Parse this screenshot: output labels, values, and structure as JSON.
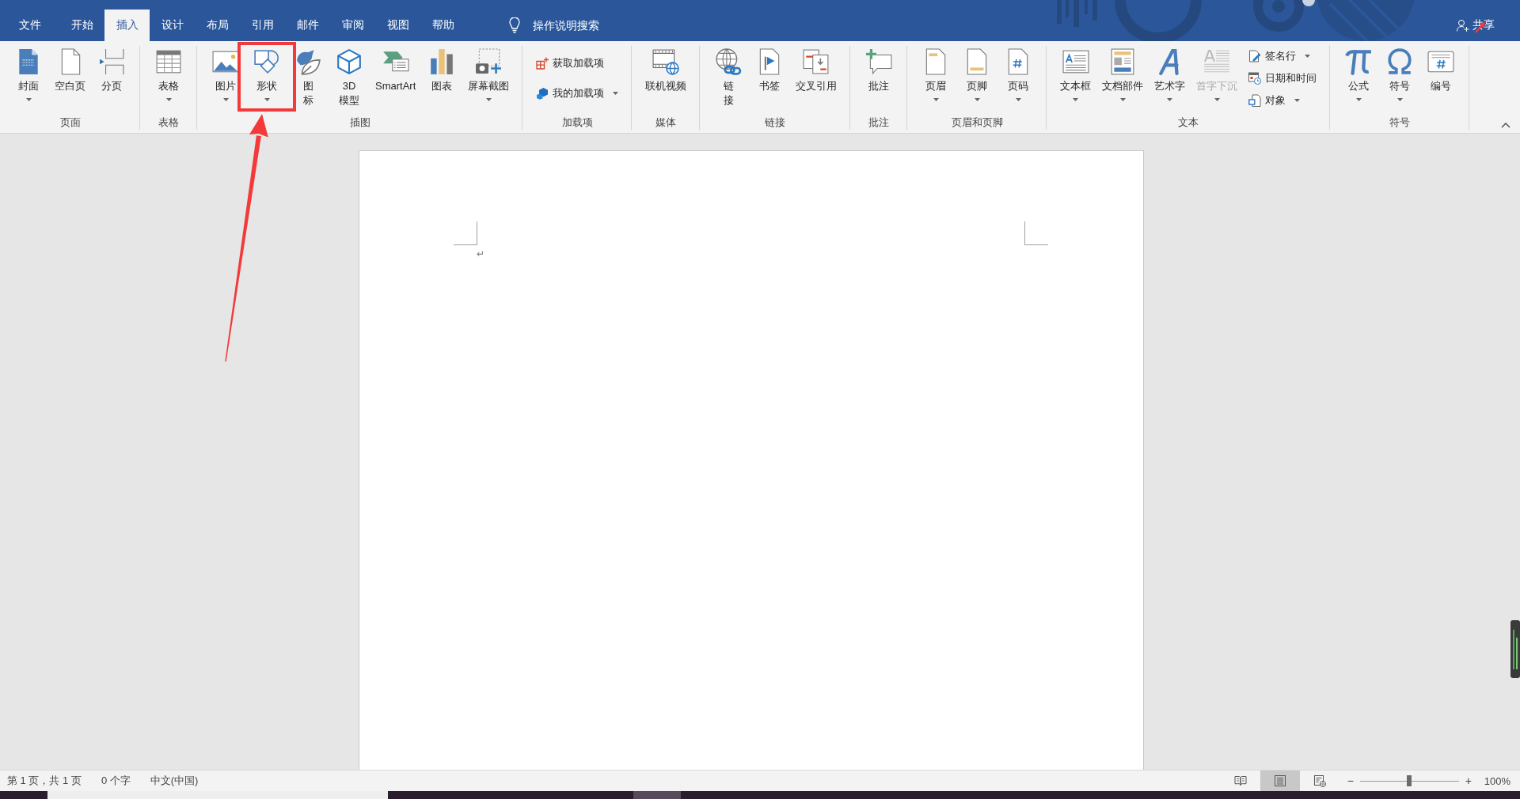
{
  "tabs": [
    {
      "label": "文件",
      "selected": false
    },
    {
      "label": "开始",
      "selected": false
    },
    {
      "label": "插入",
      "selected": true
    },
    {
      "label": "设计",
      "selected": false
    },
    {
      "label": "布局",
      "selected": false
    },
    {
      "label": "引用",
      "selected": false
    },
    {
      "label": "邮件",
      "selected": false
    },
    {
      "label": "审阅",
      "selected": false
    },
    {
      "label": "视图",
      "selected": false
    },
    {
      "label": "帮助",
      "selected": false
    }
  ],
  "tell_me": {
    "placeholder": "操作说明搜索"
  },
  "share": {
    "label": "共享"
  },
  "ribbon": {
    "groups": [
      {
        "label": "页面",
        "buttons": [
          {
            "kind": "large",
            "label": "封面",
            "dropdown": true,
            "disabled": false,
            "highlighted": false
          },
          {
            "kind": "large",
            "label": "空白页",
            "dropdown": false,
            "disabled": false,
            "highlighted": false
          },
          {
            "kind": "large",
            "label": "分页",
            "dropdown": false,
            "disabled": false,
            "highlighted": false
          }
        ]
      },
      {
        "label": "表格",
        "buttons": [
          {
            "kind": "large",
            "label": "表格",
            "dropdown": true,
            "disabled": false,
            "highlighted": false
          }
        ]
      },
      {
        "label": "插图",
        "buttons": [
          {
            "kind": "large",
            "label": "图片",
            "dropdown": true,
            "disabled": false,
            "highlighted": false
          },
          {
            "kind": "large",
            "label": "形状",
            "dropdown": true,
            "disabled": false,
            "highlighted": true
          },
          {
            "kind": "large",
            "label": "图标",
            "dropdown": false,
            "disabled": false,
            "highlighted": false
          },
          {
            "kind": "large",
            "label": "3D 模型",
            "dropdown": false,
            "disabled": false,
            "highlighted": false
          },
          {
            "kind": "large",
            "label": "SmartArt",
            "dropdown": false,
            "disabled": false,
            "highlighted": false
          },
          {
            "kind": "large",
            "label": "图表",
            "dropdown": false,
            "disabled": false,
            "highlighted": false
          },
          {
            "kind": "large",
            "label": "屏幕截图",
            "dropdown": true,
            "disabled": false,
            "highlighted": false
          }
        ]
      },
      {
        "label": "加载项",
        "buttons": [
          {
            "kind": "small",
            "label": "获取加载项",
            "dropdown": false,
            "disabled": false,
            "highlighted": false
          },
          {
            "kind": "small",
            "label": "我的加载项",
            "dropdown": true,
            "disabled": false,
            "highlighted": false
          }
        ]
      },
      {
        "label": "媒体",
        "buttons": [
          {
            "kind": "large",
            "label": "联机视频",
            "dropdown": false,
            "disabled": false,
            "highlighted": false
          }
        ]
      },
      {
        "label": "链接",
        "buttons": [
          {
            "kind": "large",
            "label": "链接",
            "dropdown": false,
            "disabled": false,
            "highlighted": false
          },
          {
            "kind": "large",
            "label": "书签",
            "dropdown": false,
            "disabled": false,
            "highlighted": false
          },
          {
            "kind": "large",
            "label": "交叉引用",
            "dropdown": false,
            "disabled": false,
            "highlighted": false
          }
        ]
      },
      {
        "label": "批注",
        "buttons": [
          {
            "kind": "large",
            "label": "批注",
            "dropdown": false,
            "disabled": false,
            "highlighted": false
          }
        ]
      },
      {
        "label": "页眉和页脚",
        "buttons": [
          {
            "kind": "large",
            "label": "页眉",
            "dropdown": true,
            "disabled": false,
            "highlighted": false
          },
          {
            "kind": "large",
            "label": "页脚",
            "dropdown": true,
            "disabled": false,
            "highlighted": false
          },
          {
            "kind": "large",
            "label": "页码",
            "dropdown": true,
            "disabled": false,
            "highlighted": false
          }
        ]
      },
      {
        "label": "文本",
        "buttons": [
          {
            "kind": "large",
            "label": "文本框",
            "dropdown": true,
            "disabled": false,
            "highlighted": false
          },
          {
            "kind": "large",
            "label": "文档部件",
            "dropdown": true,
            "disabled": false,
            "highlighted": false
          },
          {
            "kind": "large",
            "label": "艺术字",
            "dropdown": true,
            "disabled": false,
            "highlighted": false
          },
          {
            "kind": "large",
            "label": "首字下沉",
            "dropdown": true,
            "disabled": true,
            "highlighted": false
          },
          {
            "kind": "small",
            "label": "签名行",
            "dropdown": true,
            "disabled": false,
            "highlighted": false
          },
          {
            "kind": "small",
            "label": "日期和时间",
            "dropdown": false,
            "disabled": false,
            "highlighted": false
          },
          {
            "kind": "small",
            "label": "对象",
            "dropdown": true,
            "disabled": false,
            "highlighted": false
          }
        ]
      },
      {
        "label": "符号",
        "buttons": [
          {
            "kind": "large",
            "label": "公式",
            "dropdown": true,
            "disabled": false,
            "highlighted": false
          },
          {
            "kind": "large",
            "label": "符号",
            "dropdown": true,
            "disabled": false,
            "highlighted": false
          },
          {
            "kind": "large",
            "label": "编号",
            "dropdown": false,
            "disabled": false,
            "highlighted": false
          }
        ]
      }
    ]
  },
  "document": {
    "paragraph_mark": "↵"
  },
  "status_bar": {
    "items": [
      "第 1 页，共 1 页",
      "0 个字",
      "中文(中国)"
    ],
    "views": [
      {
        "selected": false
      },
      {
        "selected": true
      },
      {
        "selected": false
      }
    ],
    "zoom": {
      "minus": "−",
      "plus": "+",
      "level": 0.5,
      "reading": "100%"
    }
  }
}
